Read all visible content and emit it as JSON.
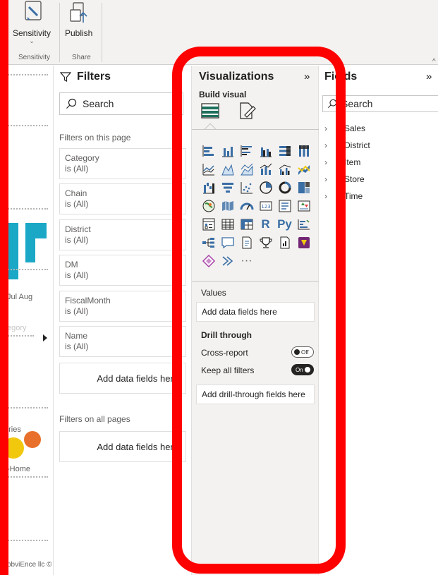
{
  "ribbon": {
    "sensitivity_label": "Sensitivity",
    "sensitivity_chevron": "⌄",
    "sensitivity_group": "Sensitivity",
    "publish_label": "Publish",
    "share_group": "Share"
  },
  "canvas": {
    "month_labels": "Jul  Aug",
    "category_faint": "egory",
    "cat_faint_top": "n",
    "bubble_label": "ories",
    "home_label": "-Home",
    "copyright": "obviEnce llc ©"
  },
  "filters": {
    "title": "Filters",
    "search_placeholder": "Search",
    "on_this_page": "Filters on this page",
    "cards": [
      {
        "name": "Category",
        "value": "is (All)"
      },
      {
        "name": "Chain",
        "value": "is (All)"
      },
      {
        "name": "District",
        "value": "is (All)"
      },
      {
        "name": "DM",
        "value": "is (All)"
      },
      {
        "name": "FiscalMonth",
        "value": "is (All)"
      },
      {
        "name": "Name",
        "value": "is (All)"
      }
    ],
    "add_fields": "Add data fields here",
    "on_all_pages": "Filters on all pages",
    "add_fields_all": "Add data fields here"
  },
  "visualizations": {
    "title": "Visualizations",
    "collapse": "»",
    "build_visual": "Build visual",
    "r_label": "R",
    "py_label": "Py",
    "more": "···",
    "values_label": "Values",
    "values_well": "Add data fields here",
    "drill_through": "Drill through",
    "cross_report": "Cross-report",
    "cross_report_state": "Off",
    "keep_filters": "Keep all filters",
    "keep_filters_state": "On",
    "drill_well": "Add drill-through fields here"
  },
  "fields": {
    "title": "Fields",
    "collapse": "»",
    "search_placeholder": "Search",
    "tables": [
      "Sales",
      "District",
      "Item",
      "Store",
      "Time"
    ]
  },
  "colors": {
    "highlight": "#ff0000",
    "accent_teal": "#1aa8c6",
    "viz_blue": "#3a6ea5"
  }
}
